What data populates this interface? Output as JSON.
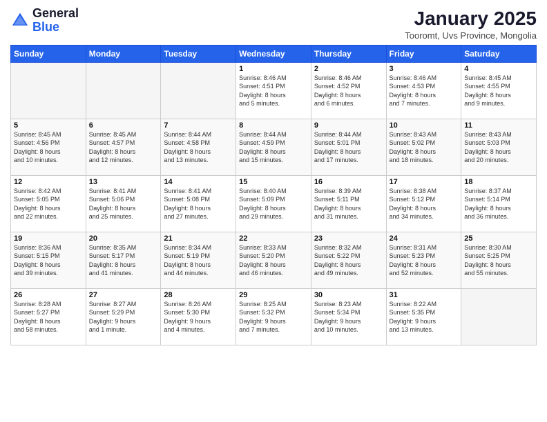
{
  "header": {
    "logo_general": "General",
    "logo_blue": "Blue",
    "title": "January 2025",
    "subtitle": "Tooromt, Uvs Province, Mongolia"
  },
  "weekdays": [
    "Sunday",
    "Monday",
    "Tuesday",
    "Wednesday",
    "Thursday",
    "Friday",
    "Saturday"
  ],
  "weeks": [
    [
      {
        "day": "",
        "info": ""
      },
      {
        "day": "",
        "info": ""
      },
      {
        "day": "",
        "info": ""
      },
      {
        "day": "1",
        "info": "Sunrise: 8:46 AM\nSunset: 4:51 PM\nDaylight: 8 hours\nand 5 minutes."
      },
      {
        "day": "2",
        "info": "Sunrise: 8:46 AM\nSunset: 4:52 PM\nDaylight: 8 hours\nand 6 minutes."
      },
      {
        "day": "3",
        "info": "Sunrise: 8:46 AM\nSunset: 4:53 PM\nDaylight: 8 hours\nand 7 minutes."
      },
      {
        "day": "4",
        "info": "Sunrise: 8:45 AM\nSunset: 4:55 PM\nDaylight: 8 hours\nand 9 minutes."
      }
    ],
    [
      {
        "day": "5",
        "info": "Sunrise: 8:45 AM\nSunset: 4:56 PM\nDaylight: 8 hours\nand 10 minutes."
      },
      {
        "day": "6",
        "info": "Sunrise: 8:45 AM\nSunset: 4:57 PM\nDaylight: 8 hours\nand 12 minutes."
      },
      {
        "day": "7",
        "info": "Sunrise: 8:44 AM\nSunset: 4:58 PM\nDaylight: 8 hours\nand 13 minutes."
      },
      {
        "day": "8",
        "info": "Sunrise: 8:44 AM\nSunset: 4:59 PM\nDaylight: 8 hours\nand 15 minutes."
      },
      {
        "day": "9",
        "info": "Sunrise: 8:44 AM\nSunset: 5:01 PM\nDaylight: 8 hours\nand 17 minutes."
      },
      {
        "day": "10",
        "info": "Sunrise: 8:43 AM\nSunset: 5:02 PM\nDaylight: 8 hours\nand 18 minutes."
      },
      {
        "day": "11",
        "info": "Sunrise: 8:43 AM\nSunset: 5:03 PM\nDaylight: 8 hours\nand 20 minutes."
      }
    ],
    [
      {
        "day": "12",
        "info": "Sunrise: 8:42 AM\nSunset: 5:05 PM\nDaylight: 8 hours\nand 22 minutes."
      },
      {
        "day": "13",
        "info": "Sunrise: 8:41 AM\nSunset: 5:06 PM\nDaylight: 8 hours\nand 25 minutes."
      },
      {
        "day": "14",
        "info": "Sunrise: 8:41 AM\nSunset: 5:08 PM\nDaylight: 8 hours\nand 27 minutes."
      },
      {
        "day": "15",
        "info": "Sunrise: 8:40 AM\nSunset: 5:09 PM\nDaylight: 8 hours\nand 29 minutes."
      },
      {
        "day": "16",
        "info": "Sunrise: 8:39 AM\nSunset: 5:11 PM\nDaylight: 8 hours\nand 31 minutes."
      },
      {
        "day": "17",
        "info": "Sunrise: 8:38 AM\nSunset: 5:12 PM\nDaylight: 8 hours\nand 34 minutes."
      },
      {
        "day": "18",
        "info": "Sunrise: 8:37 AM\nSunset: 5:14 PM\nDaylight: 8 hours\nand 36 minutes."
      }
    ],
    [
      {
        "day": "19",
        "info": "Sunrise: 8:36 AM\nSunset: 5:15 PM\nDaylight: 8 hours\nand 39 minutes."
      },
      {
        "day": "20",
        "info": "Sunrise: 8:35 AM\nSunset: 5:17 PM\nDaylight: 8 hours\nand 41 minutes."
      },
      {
        "day": "21",
        "info": "Sunrise: 8:34 AM\nSunset: 5:19 PM\nDaylight: 8 hours\nand 44 minutes."
      },
      {
        "day": "22",
        "info": "Sunrise: 8:33 AM\nSunset: 5:20 PM\nDaylight: 8 hours\nand 46 minutes."
      },
      {
        "day": "23",
        "info": "Sunrise: 8:32 AM\nSunset: 5:22 PM\nDaylight: 8 hours\nand 49 minutes."
      },
      {
        "day": "24",
        "info": "Sunrise: 8:31 AM\nSunset: 5:23 PM\nDaylight: 8 hours\nand 52 minutes."
      },
      {
        "day": "25",
        "info": "Sunrise: 8:30 AM\nSunset: 5:25 PM\nDaylight: 8 hours\nand 55 minutes."
      }
    ],
    [
      {
        "day": "26",
        "info": "Sunrise: 8:28 AM\nSunset: 5:27 PM\nDaylight: 8 hours\nand 58 minutes."
      },
      {
        "day": "27",
        "info": "Sunrise: 8:27 AM\nSunset: 5:29 PM\nDaylight: 9 hours\nand 1 minute."
      },
      {
        "day": "28",
        "info": "Sunrise: 8:26 AM\nSunset: 5:30 PM\nDaylight: 9 hours\nand 4 minutes."
      },
      {
        "day": "29",
        "info": "Sunrise: 8:25 AM\nSunset: 5:32 PM\nDaylight: 9 hours\nand 7 minutes."
      },
      {
        "day": "30",
        "info": "Sunrise: 8:23 AM\nSunset: 5:34 PM\nDaylight: 9 hours\nand 10 minutes."
      },
      {
        "day": "31",
        "info": "Sunrise: 8:22 AM\nSunset: 5:35 PM\nDaylight: 9 hours\nand 13 minutes."
      },
      {
        "day": "",
        "info": ""
      }
    ]
  ]
}
